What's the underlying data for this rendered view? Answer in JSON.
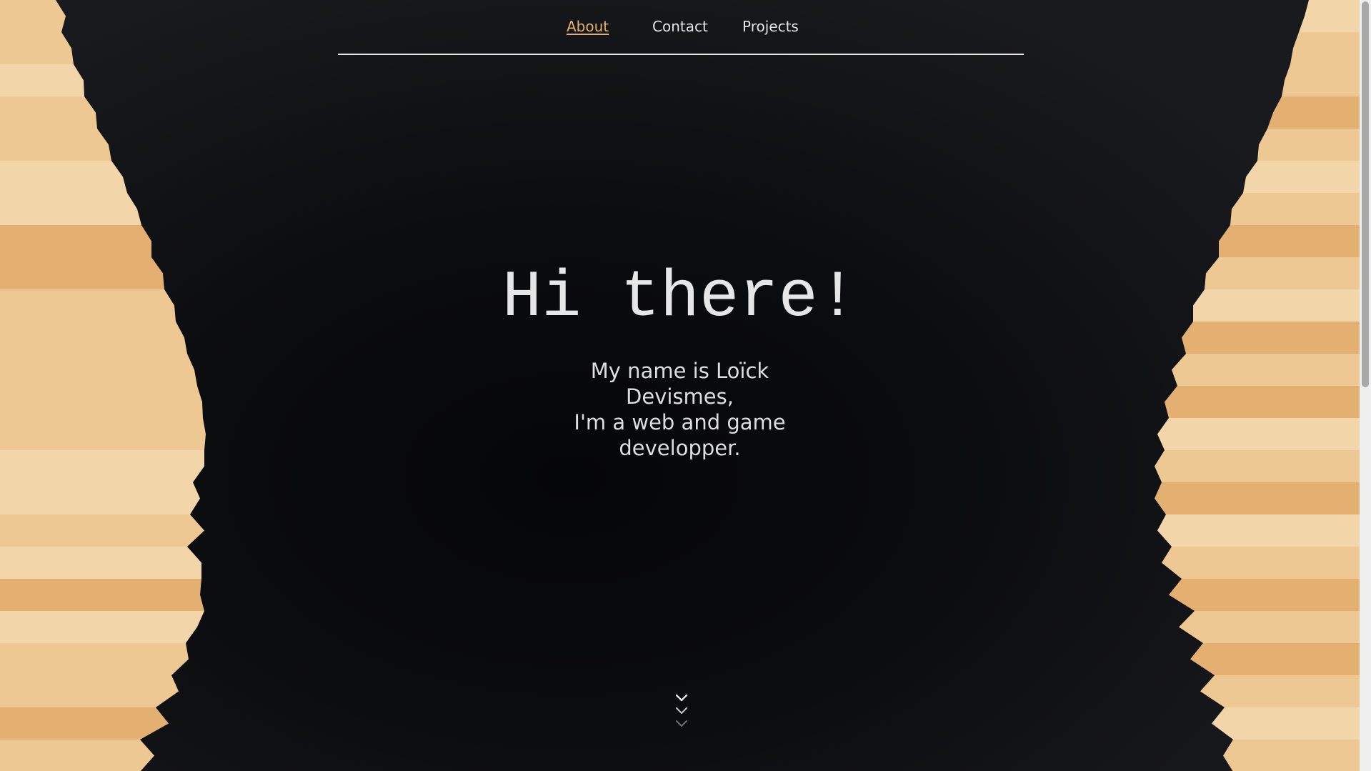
{
  "nav": {
    "items": [
      {
        "label": "About",
        "active": true
      },
      {
        "label": "Contact",
        "active": false
      },
      {
        "label": "Projects",
        "active": false
      }
    ]
  },
  "hero": {
    "title": "Hi there!",
    "subtitle_lines": [
      "My name is Loïck",
      "Devismes,",
      "I'm a web and game",
      "developper."
    ]
  },
  "scroll_hint": {
    "icon": "triple-chevron-down-icon"
  },
  "colors": {
    "accent": "#e2b06e",
    "background": "#0f1012",
    "text": "#e4e4e4",
    "stripe_light": "#f3d5aa",
    "stripe_mid": "#edc893",
    "stripe_dark": "#e4b071"
  }
}
